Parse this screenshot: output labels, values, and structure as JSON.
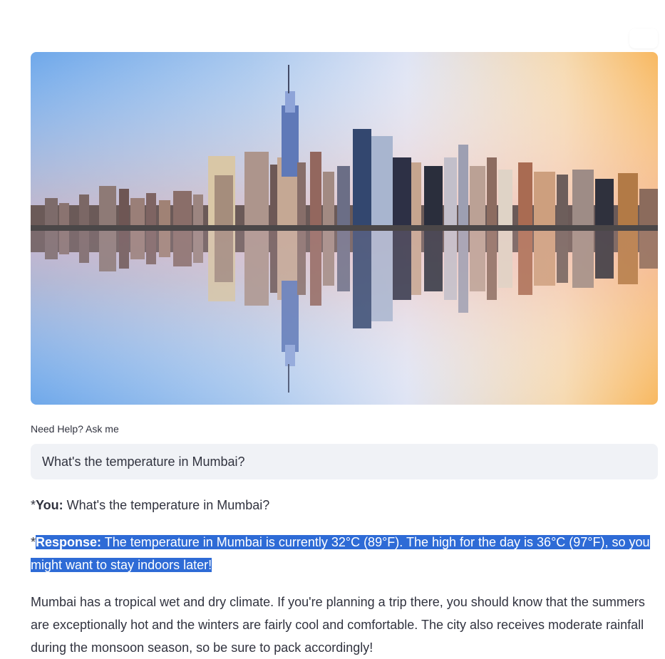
{
  "hero": {
    "image_name": "city-skyline-reflection-image"
  },
  "input": {
    "label": "Need Help? Ask me",
    "value": "What's the temperature in Mumbai?"
  },
  "messages": {
    "you": {
      "prefix": "*",
      "label": "You:",
      "text": " What's the temperature in Mumbai?"
    },
    "response": {
      "prefix": "*",
      "label": "Response:",
      "text": " The temperature in Mumbai is currently 32°C (89°F). The high for the day is 36°C (97°F), so you might want to stay indoors later!"
    },
    "info": {
      "text": "Mumbai has a tropical wet and dry climate. If you're planning a trip there, you should know that the summers are exceptionally hot and the winters are fairly cool and comfortable. The city also receives moderate rainfall during the monsoon season, so be sure to pack accordingly!"
    }
  },
  "colors": {
    "selection": "#2e6bd6",
    "input_bg": "#f0f2f6",
    "text": "#31333f"
  }
}
